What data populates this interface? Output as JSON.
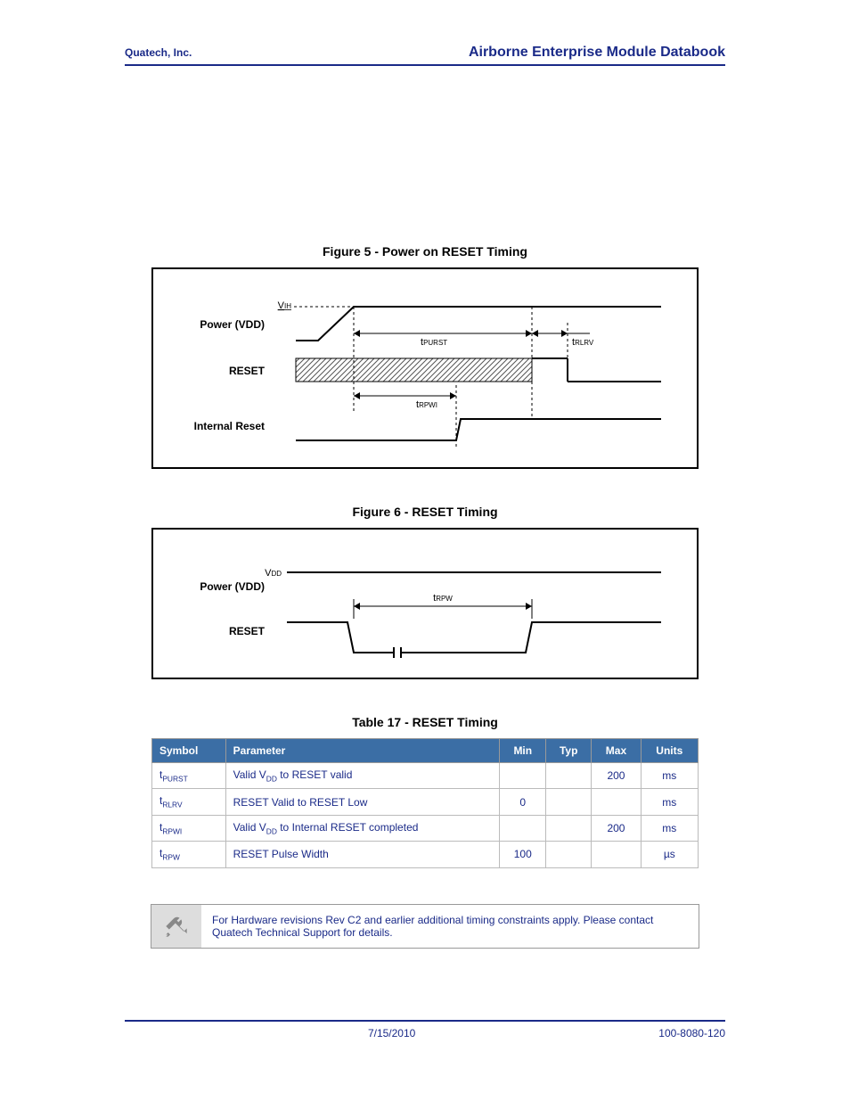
{
  "header": {
    "company": "Quatech, Inc.",
    "doctitle": "Airborne Enterprise Module Databook"
  },
  "figure5": {
    "caption": "Figure 5 - Power on RESET Timing",
    "labels": {
      "vih": "V",
      "vih_sub": "IH",
      "power": "Power (VDD)",
      "tpurst": "t",
      "tpurst_sub": "PURST",
      "trlrv": "t",
      "trlrv_sub": "RLRV",
      "reset": "RESET",
      "trpwi": "t",
      "trpwi_sub": "RPWI",
      "internal_reset": "Internal Reset"
    }
  },
  "figure6": {
    "caption": "Figure 6 - RESET Timing",
    "labels": {
      "vdd": "V",
      "vdd_sub": "DD",
      "power": "Power (VDD)",
      "trpw": "t",
      "trpw_sub": "RPW",
      "reset": "RESET"
    }
  },
  "table17": {
    "caption": "Table 17 - RESET Timing",
    "headers": [
      "Symbol",
      "Parameter",
      "Min",
      "Typ",
      "Max",
      "Units"
    ],
    "rows": [
      {
        "sym": "t",
        "sym_sub": "PURST",
        "param_pre": "Valid V",
        "param_sub": "DD",
        "param_post": " to RESET valid",
        "min": "",
        "typ": "",
        "max": "200",
        "units": "ms"
      },
      {
        "sym": "t",
        "sym_sub": "RLRV",
        "param_pre": "RESET Valid to RESET Low",
        "param_sub": "",
        "param_post": "",
        "min": "0",
        "typ": "",
        "max": "",
        "units": "ms"
      },
      {
        "sym": "t",
        "sym_sub": "RPWI",
        "param_pre": "Valid V",
        "param_sub": "DD",
        "param_post": " to Internal RESET completed",
        "min": "",
        "typ": "",
        "max": "200",
        "units": "ms"
      },
      {
        "sym": "t",
        "sym_sub": "RPW",
        "param_pre": "RESET Pulse Width",
        "param_sub": "",
        "param_post": "",
        "min": "100",
        "typ": "",
        "max": "",
        "units": "µs"
      }
    ]
  },
  "note": "For Hardware revisions Rev C2 and earlier additional timing constraints apply. Please contact Quatech Technical Support for details.",
  "footer": {
    "date": "7/15/2010",
    "docnum": "100-8080-120"
  }
}
